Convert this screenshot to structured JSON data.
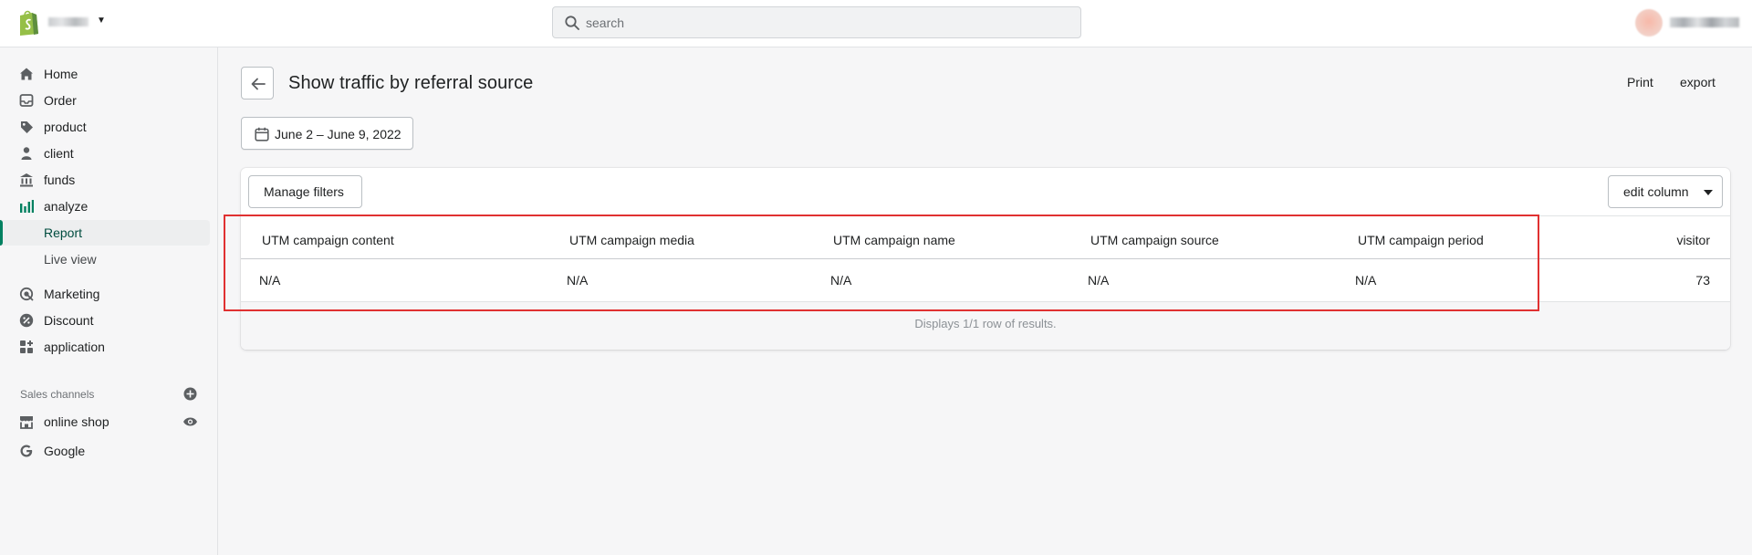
{
  "topbar": {
    "search_placeholder": "search"
  },
  "sidebar": {
    "items": [
      {
        "label": "Home",
        "icon": "home-icon"
      },
      {
        "label": "Order",
        "icon": "inbox-icon"
      },
      {
        "label": "product",
        "icon": "tag-icon"
      },
      {
        "label": "client",
        "icon": "person-icon"
      },
      {
        "label": "funds",
        "icon": "bank-icon"
      },
      {
        "label": "analyze",
        "icon": "bar-chart-icon"
      },
      {
        "label": "Report"
      },
      {
        "label": "Live view"
      },
      {
        "label": "Marketing",
        "icon": "target-icon"
      },
      {
        "label": "Discount",
        "icon": "discount-icon"
      },
      {
        "label": "application",
        "icon": "apps-icon"
      }
    ],
    "sales_channels_title": "Sales channels",
    "channels": [
      {
        "label": "online shop",
        "icon": "store-icon"
      },
      {
        "label": "Google",
        "icon": "google-icon"
      }
    ]
  },
  "page": {
    "title": "Show traffic by referral source",
    "print_label": "Print",
    "export_label": "export",
    "date_range": "June 2 – June 9, 2022"
  },
  "report": {
    "manage_filters_label": "Manage filters",
    "edit_column_label": "edit column",
    "columns": [
      "UTM campaign content",
      "UTM campaign media",
      "UTM campaign name",
      "UTM campaign source",
      "UTM campaign period",
      "visitor"
    ],
    "rows": [
      [
        "N/A",
        "N/A",
        "N/A",
        "N/A",
        "N/A",
        "73"
      ]
    ],
    "footer_text": "Displays 1/1 row of results."
  },
  "colors": {
    "accent": "#008060",
    "highlight": "#e03131"
  }
}
